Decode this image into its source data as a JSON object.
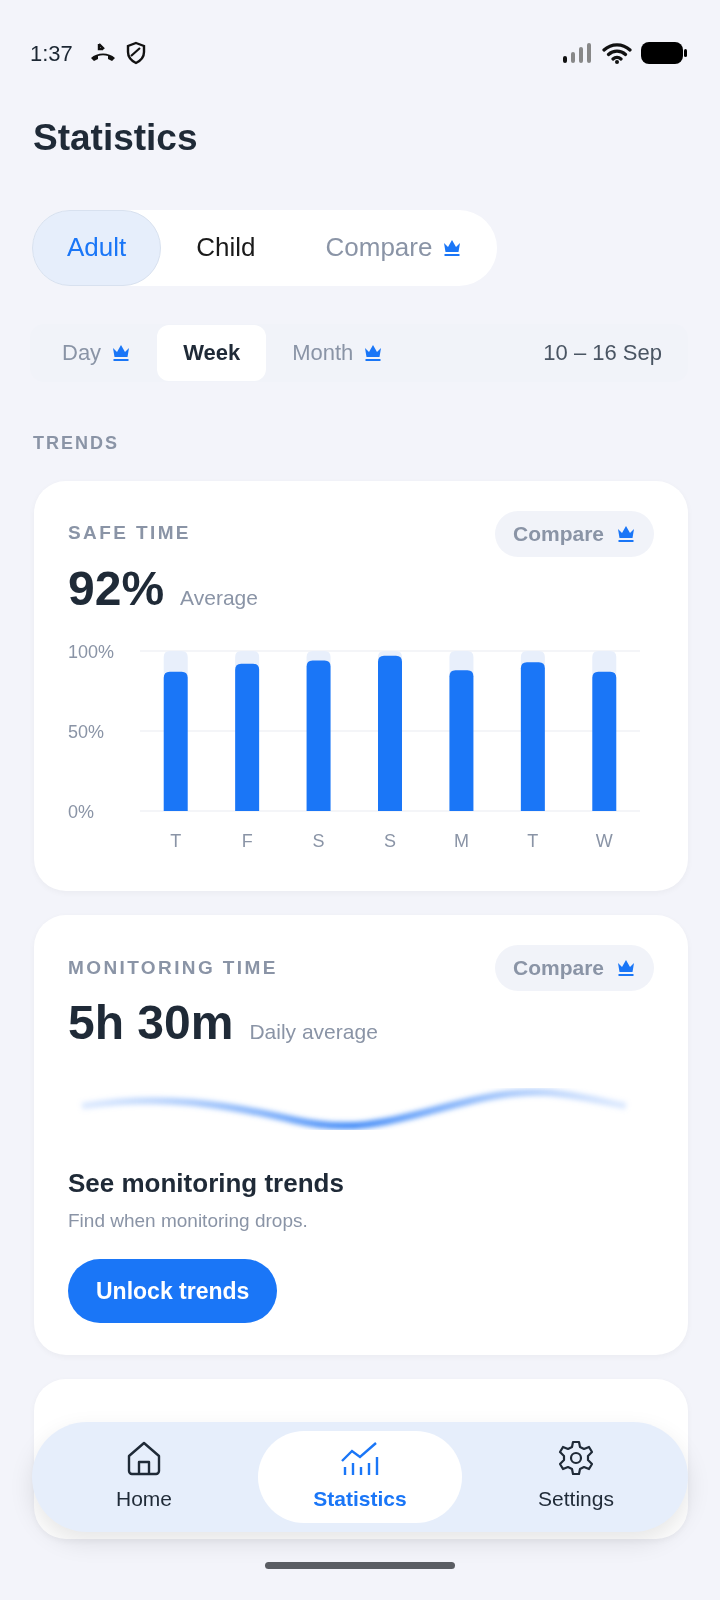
{
  "status_bar": {
    "time": "1:37"
  },
  "title": "Statistics",
  "profile_tabs": [
    {
      "label": "Adult",
      "selected": true,
      "premium": false
    },
    {
      "label": "Child",
      "selected": false,
      "premium": false
    },
    {
      "label": "Compare",
      "selected": false,
      "premium": true
    }
  ],
  "period_tabs": [
    {
      "label": "Day",
      "selected": false,
      "premium": true
    },
    {
      "label": "Week",
      "selected": true,
      "premium": false
    },
    {
      "label": "Month",
      "selected": false,
      "premium": true
    }
  ],
  "date_range": "10 – 16 Sep",
  "section_label": "TRENDS",
  "cards": [
    {
      "kind": "chart",
      "title": "SAFE TIME",
      "compare": "Compare",
      "value": "92%",
      "caption": "Average",
      "chart_data": {
        "type": "bar",
        "categories": [
          "T",
          "F",
          "S",
          "S",
          "M",
          "T",
          "W"
        ],
        "series": [
          {
            "color": "#1a76f7",
            "values": [
              87,
              92,
              94,
              97,
              88,
              93,
              87
            ]
          }
        ],
        "ylim": [
          0,
          100
        ],
        "yticks": [
          {
            "value": 0,
            "label": "0%"
          },
          {
            "value": 50,
            "label": "50%"
          },
          {
            "value": 100,
            "label": "100%"
          }
        ]
      }
    },
    {
      "kind": "locked",
      "title": "MONITORING TIME",
      "compare": "Compare",
      "value": "5h 30m",
      "caption": "Daily average",
      "heading": "See monitoring trends",
      "text": "Find when monitoring drops.",
      "button": "Unlock trends"
    },
    {
      "kind": "partial"
    }
  ],
  "nav": [
    {
      "label": "Home",
      "selected": false
    },
    {
      "label": "Statistics",
      "selected": true
    },
    {
      "label": "Settings",
      "selected": false
    }
  ]
}
